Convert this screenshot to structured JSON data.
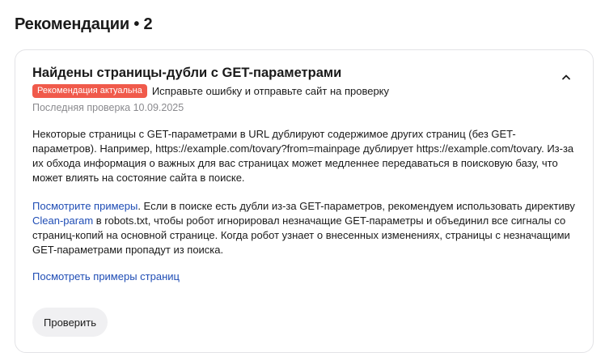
{
  "section": {
    "title": "Рекомендации • 2"
  },
  "card": {
    "title": "Найдены страницы-дубли с GET-параметрами",
    "collapse_icon": "chevron-up-icon",
    "badge": "Рекомендация актуальна",
    "badge_color": "#f05a4b",
    "status_text": "Исправьте ошибку и отправьте сайт на проверку",
    "last_check": "Последняя проверка 10.09.2025",
    "paragraph1": "Некоторые страницы с GET-параметрами в URL дублируют содержимое других страниц (без GET-параметров). Например, https://example.com/tovary?from=mainpage дублирует https://example.com/tovary. Из-за их обхода информация о важных для вас страницах может медленнее передаваться в поисковую базу, что может влиять на состояние сайта в поиске.",
    "paragraph2_link1": "Посмотрите примеры",
    "paragraph2_text1": ". Если в поиске есть дубли из-за GET-параметров, рекомендуем использовать директиву ",
    "paragraph2_link2": "Clean-param",
    "paragraph2_text2": " в robots.txt, чтобы робот игнорировал незначащие GET-параметры и объединил все сигналы со страниц-копий на основной странице. Когда робот узнает о внесенных изменениях, страницы с незначащими GET-параметрами пропадут из поиска.",
    "examples_link": "Посмотреть примеры страниц",
    "check_button": "Проверить",
    "link_color": "#1f4db5"
  }
}
